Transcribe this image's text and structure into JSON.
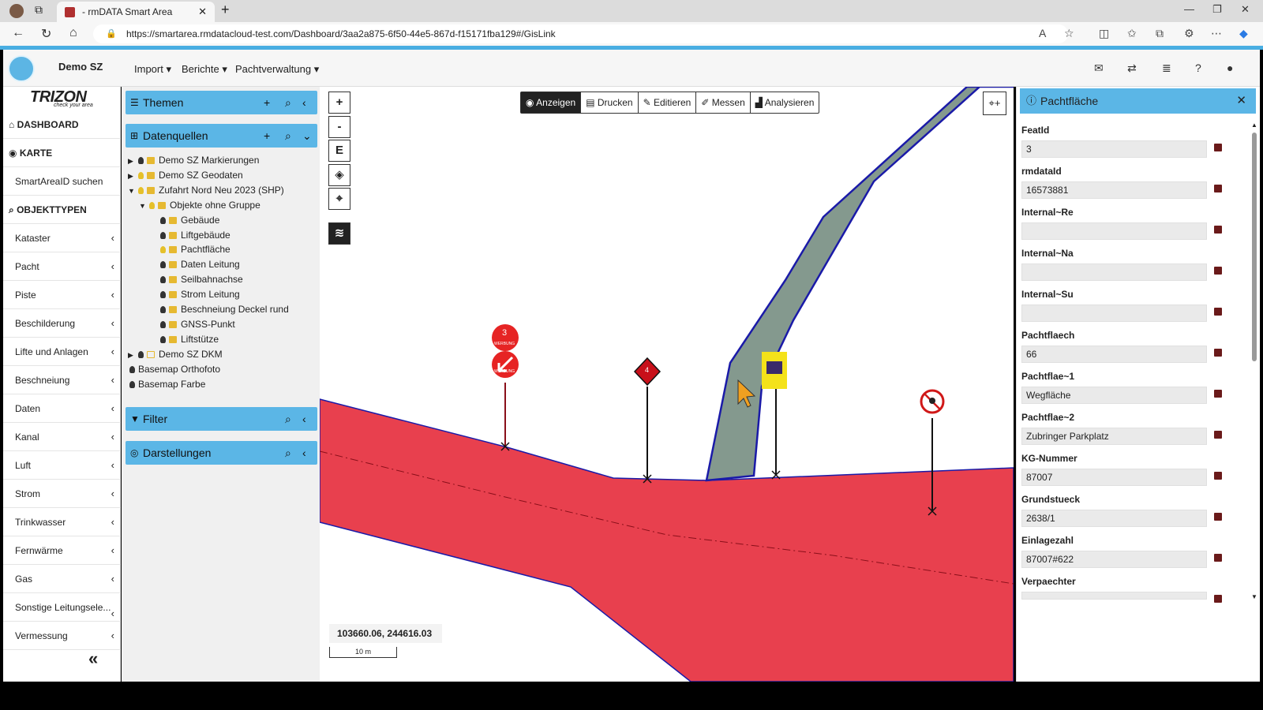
{
  "browser": {
    "tab_title": "- rmDATA Smart Area",
    "url": "https://smartarea.rmdatacloud-test.com/Dashboard/3aa2a875-6f50-44e5-867d-f15171fba129#/GisLink"
  },
  "header": {
    "brand": "Demo SZ",
    "menus": [
      "Import",
      "Berichte",
      "Pachtverwaltung"
    ]
  },
  "sidebar": {
    "logo": "TRIZON",
    "logo_sub": "check your area",
    "items": [
      {
        "label": "DASHBOARD",
        "icon": "home-icon",
        "strong": true
      },
      {
        "label": "KARTE",
        "icon": "globe-icon",
        "strong": true
      },
      {
        "label": "SmartAreaID suchen"
      },
      {
        "label": "OBJEKTTYPEN",
        "icon": "search-icon",
        "strong": true
      },
      {
        "label": "Kataster"
      },
      {
        "label": "Pacht"
      },
      {
        "label": "Piste"
      },
      {
        "label": "Beschilderung"
      },
      {
        "label": "Lifte und Anlagen"
      },
      {
        "label": "Beschneiung"
      },
      {
        "label": "Daten"
      },
      {
        "label": "Kanal"
      },
      {
        "label": "Luft"
      },
      {
        "label": "Strom"
      },
      {
        "label": "Trinkwasser"
      },
      {
        "label": "Fernwärme"
      },
      {
        "label": "Gas"
      },
      {
        "label": "Sonstige Leitungsele..."
      },
      {
        "label": "Vermessung"
      }
    ]
  },
  "panels": {
    "themen": "Themen",
    "datenquellen": "Datenquellen",
    "filter": "Filter",
    "darstellungen": "Darstellungen"
  },
  "tree": [
    {
      "label": "Demo SZ Markierungen",
      "level": 0,
      "arrow": "▶",
      "bulb": "dark",
      "lock": "filled"
    },
    {
      "label": "Demo SZ Geodaten",
      "level": 0,
      "arrow": "▶",
      "bulb": "yellow",
      "lock": "filled"
    },
    {
      "label": "Zufahrt Nord Neu 2023 (SHP)",
      "level": 0,
      "arrow": "▼",
      "bulb": "yellow",
      "lock": "filled"
    },
    {
      "label": "Objekte ohne Gruppe",
      "level": 1,
      "arrow": "▼",
      "bulb": "yellow",
      "lock": "filled"
    },
    {
      "label": "Gebäude",
      "level": 2,
      "bulb": "dark",
      "lock": "filled"
    },
    {
      "label": "Liftgebäude",
      "level": 2,
      "bulb": "dark",
      "lock": "filled"
    },
    {
      "label": "Pachtfläche",
      "level": 2,
      "bulb": "yellow",
      "lock": "filled"
    },
    {
      "label": "Daten Leitung",
      "level": 2,
      "bulb": "dark",
      "lock": "filled"
    },
    {
      "label": "Seilbahnachse",
      "level": 2,
      "bulb": "dark",
      "lock": "filled"
    },
    {
      "label": "Strom Leitung",
      "level": 2,
      "bulb": "dark",
      "lock": "filled"
    },
    {
      "label": "Beschneiung Deckel rund",
      "level": 2,
      "bulb": "dark",
      "lock": "filled"
    },
    {
      "label": "GNSS-Punkt",
      "level": 2,
      "bulb": "dark",
      "lock": "filled"
    },
    {
      "label": "Liftstütze",
      "level": 2,
      "bulb": "dark",
      "lock": "filled"
    },
    {
      "label": "Demo SZ DKM",
      "level": 0,
      "arrow": "▶",
      "bulb": "dark",
      "lock": "outline"
    },
    {
      "label": "Basemap Orthofoto",
      "level": -1,
      "bulb": "dark"
    },
    {
      "label": "Basemap Farbe",
      "level": -1,
      "bulb": "dark"
    }
  ],
  "map_toolbar": [
    "Anzeigen",
    "Drucken",
    "Editieren",
    "Messen",
    "Analysieren"
  ],
  "map_zoom": [
    "+",
    "-",
    "E"
  ],
  "map": {
    "coords": "103660.06, 244616.03",
    "scale": "10 m",
    "sign_number": "3",
    "sign_text": "WERBUNG",
    "diamond_number": "4",
    "colors": {
      "red_area": "#e8404e",
      "green_path": "#84998e",
      "outline": "#1a1aa8"
    }
  },
  "detail": {
    "title": "Pachtfläche",
    "fields": [
      {
        "label": "FeatId",
        "value": "3"
      },
      {
        "label": "rmdataId",
        "value": "16573881"
      },
      {
        "label": "Internal~Re",
        "value": ""
      },
      {
        "label": "Internal~Na",
        "value": ""
      },
      {
        "label": "Internal~Su",
        "value": ""
      },
      {
        "label": "Pachtflaech",
        "value": "66"
      },
      {
        "label": "Pachtflae~1",
        "value": "Wegfläche"
      },
      {
        "label": "Pachtflae~2",
        "value": "Zubringer Parkplatz"
      },
      {
        "label": "KG-Nummer",
        "value": "87007"
      },
      {
        "label": "Grundstueck",
        "value": "2638/1"
      },
      {
        "label": "Einlagezahl",
        "value": "87007#622"
      },
      {
        "label": "Verpaechter",
        "value": ""
      }
    ]
  }
}
